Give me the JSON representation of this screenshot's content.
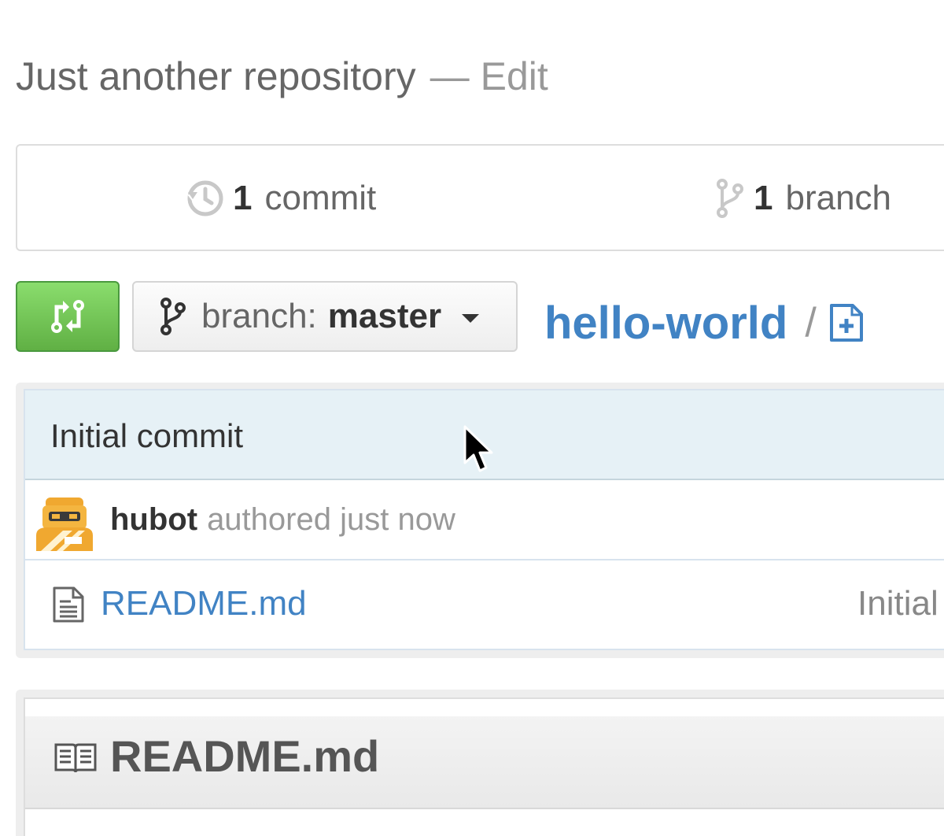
{
  "repository": {
    "description": "Just another repository",
    "separator": "—",
    "edit_label": "Edit",
    "name": "hello-world",
    "path_separator": "/"
  },
  "numbers_summary": {
    "commits": {
      "count": "1",
      "label": "commit",
      "icon": "history-icon"
    },
    "branches": {
      "count": "1",
      "label": "branch",
      "icon": "git-branch-icon"
    }
  },
  "file_navigation": {
    "compare_button_icon": "compare-icon",
    "branch_select": {
      "prefix": "branch:",
      "current": "master",
      "icon": "git-branch-icon",
      "caret_icon": "triangle-down-icon"
    },
    "new_file_icon": "new-file-icon"
  },
  "latest_commit": {
    "title": "Initial commit",
    "author": "hubot",
    "meta": "authored just now",
    "avatar": "hubot-avatar"
  },
  "files": [
    {
      "name": "README.md",
      "icon": "file-text-icon",
      "message": "Initial"
    }
  ],
  "readme": {
    "title": "README.md",
    "icon": "book-icon"
  },
  "colors": {
    "link": "#4183c4",
    "button_green": "#60b044",
    "commit_bar": "#e6f1f6"
  }
}
